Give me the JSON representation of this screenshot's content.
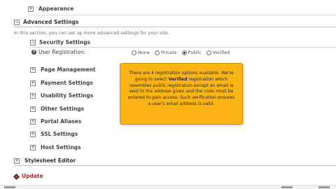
{
  "sections": {
    "appearance": "Appearance",
    "advanced": "Advanced Settings",
    "advanced_description": "In this section, you can set up more advanced settings for your site.",
    "stylesheet": "Stylesheet Editor"
  },
  "subsections": [
    {
      "label": "Security Settings"
    },
    {
      "label": "Page Management"
    },
    {
      "label": "Payment Settings"
    },
    {
      "label": "Usability Settings"
    },
    {
      "label": "Other Settings"
    },
    {
      "label": "Portal Aliases"
    },
    {
      "label": "SSL Settings"
    },
    {
      "label": "Host Settings"
    }
  ],
  "user_registration": {
    "label": "User Registration:",
    "options": [
      "None",
      "Private",
      "Public",
      "Verified"
    ],
    "selected": "Public"
  },
  "callout": {
    "part1": "There are 4 registration options available. We're going to select ",
    "highlight": "Verified",
    "part2": " registration which resembles public registration except an email is sent to the address given and the code must be entered to gain access. Such verification ensures a user's email address is valid."
  },
  "update_label": "Update",
  "colors": {
    "callout_bg": "#fbb316",
    "update_text": "#b32424",
    "section_rule": "#b5c8de"
  }
}
